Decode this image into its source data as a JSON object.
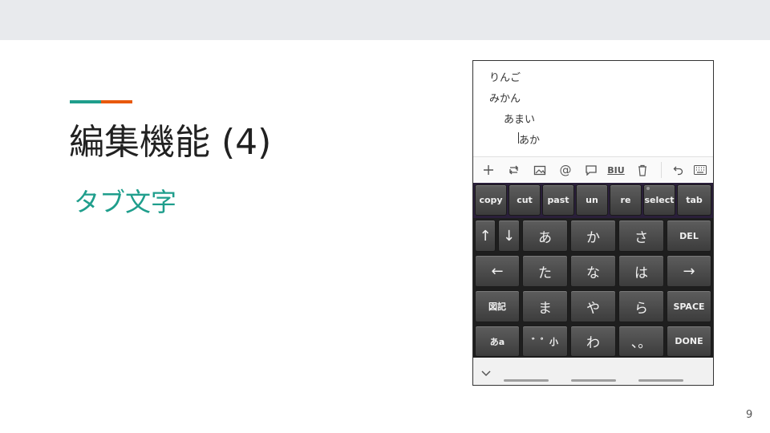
{
  "slide": {
    "title": "編集機能 (4)",
    "subtitle": "タブ文字",
    "page_number": "9",
    "colors": {
      "accent_left": "#1f9e8c",
      "accent_right": "#e8590c",
      "subtitle": "#1f9e8c",
      "top_band": "#e8eaed"
    }
  },
  "editor": {
    "lines": [
      "りんご",
      "みかん",
      "あまい",
      "あか"
    ]
  },
  "toolbar": {
    "icons": [
      "plus-icon",
      "repeat-icon",
      "image-icon",
      "at-sign-icon",
      "comment-icon",
      "bold-italic-underline-icon",
      "trash-icon",
      "undo-icon",
      "keyboard-icon"
    ],
    "biu_label": "BIU"
  },
  "keyboard": {
    "row1": [
      "copy",
      "cut",
      "past",
      "un",
      "re",
      "select",
      "tab"
    ],
    "row2": [
      "↑",
      "↓",
      "あ",
      "か",
      "さ",
      "DEL"
    ],
    "row3": [
      "←",
      "た",
      "な",
      "は",
      "→"
    ],
    "row4": [
      "図記",
      "ま",
      "や",
      "ら",
      "SPACE"
    ],
    "row5": [
      "あa",
      "゛゜小",
      "わ",
      "、。",
      "DONE"
    ]
  },
  "navbar": {
    "icons": [
      "chevron-down-icon"
    ]
  }
}
